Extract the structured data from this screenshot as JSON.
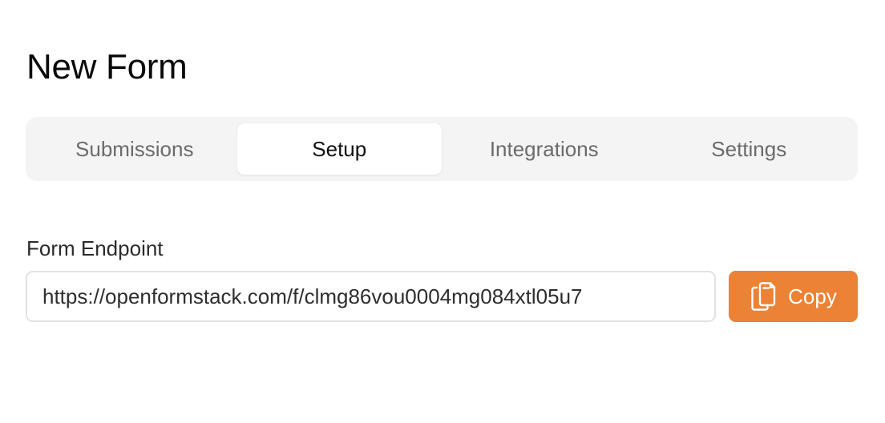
{
  "page": {
    "title": "New Form"
  },
  "tabs": [
    {
      "label": "Submissions",
      "active": false
    },
    {
      "label": "Setup",
      "active": true
    },
    {
      "label": "Integrations",
      "active": false
    },
    {
      "label": "Settings",
      "active": false
    }
  ],
  "endpoint": {
    "label": "Form Endpoint",
    "value": "https://openformstack.com/f/clmg86vou0004mg084xtl05u7"
  },
  "copy_button": {
    "label": "Copy",
    "icon": "clipboard-copy-icon"
  },
  "colors": {
    "accent": "#ec8235",
    "tab_bar_bg": "#f4f4f5",
    "active_tab_bg": "#ffffff"
  }
}
